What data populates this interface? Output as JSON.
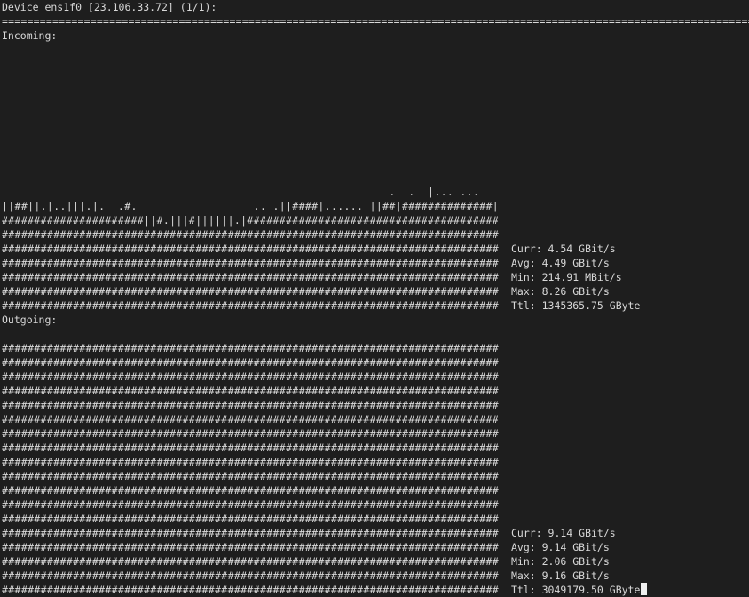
{
  "header": {
    "title": "Device ens1f0 [23.106.33.72] (1/1):",
    "separator": "=========================================================================================================================="
  },
  "incoming": {
    "label": "Incoming:",
    "graph": [
      "",
      "",
      "",
      "",
      "",
      "",
      "",
      "",
      "",
      "",
      "                                                            .  .  |... ...",
      "||##||.|..|||.|.  .#.                  .. .||####|...... ||##|##############|..#",
      "######################||#.|||#||||||.|########################################",
      "################################################################################",
      "################################################################################",
      "################################################################################",
      "################################################################################",
      "################################################################################",
      "################################################################################"
    ],
    "stats": {
      "curr": "Curr: 4.54 GBit/s",
      "avg": "Avg: 4.49 GBit/s",
      "min": "Min: 214.91 MBit/s",
      "max": "Max: 8.26 GBit/s",
      "ttl": "Ttl: 1345365.75 GByte"
    }
  },
  "outgoing": {
    "label": "Outgoing:",
    "graph": [
      "",
      "################################################################################",
      "################################################################################",
      "################################################################################",
      "################################################################################",
      "################################################################################",
      "################################################################################",
      "################################################################################",
      "################################################################################",
      "################################################################################",
      "################################################################################",
      "################################################################################",
      "################################################################################",
      "################################################################################",
      "################################################################################",
      "################################################################################",
      "################################################################################",
      "################################################################################",
      "################################################################################"
    ],
    "stats": {
      "curr": "Curr: 9.14 GBit/s",
      "avg": "Avg: 9.14 GBit/s",
      "min": "Min: 2.06 GBit/s",
      "max": "Max: 9.16 GBit/s",
      "ttl": "Ttl: 3049179.50 GByte"
    }
  }
}
